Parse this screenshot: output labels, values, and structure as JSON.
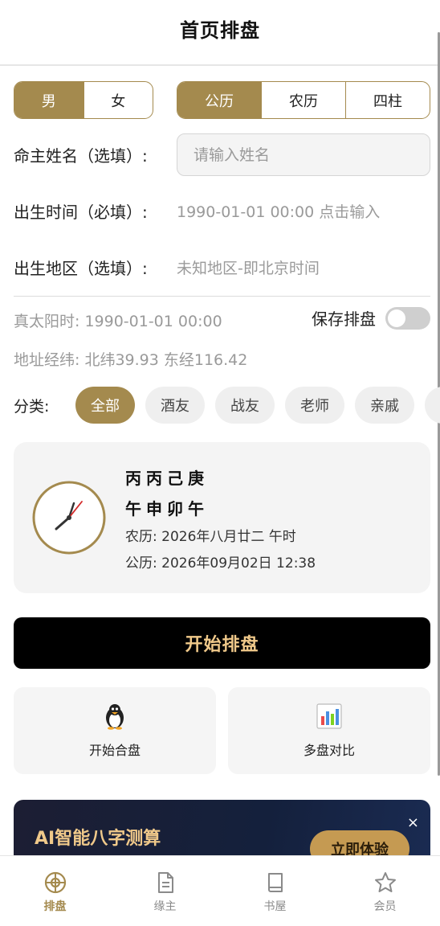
{
  "header": {
    "title": "首页排盘"
  },
  "gender": {
    "options": [
      "男",
      "女"
    ],
    "selected": 0
  },
  "calendar": {
    "options": [
      "公历",
      "农历",
      "四柱"
    ],
    "selected": 0
  },
  "form": {
    "name_label": "命主姓名（选填）:",
    "name_placeholder": "请输入姓名",
    "time_label": "出生时间（必填）:",
    "time_value": "1990-01-01 00:00 点击输入",
    "place_label": "出生地区（选填）:",
    "place_value": "未知地区-即北京时间"
  },
  "solar_time": "真太阳时: 1990-01-01 00:00",
  "save": {
    "label": "保存排盘",
    "enabled": false
  },
  "coords": "地址经纬: 北纬39.93 东经116.42",
  "category": {
    "label": "分类:",
    "chips": [
      "全部",
      "酒友",
      "战友",
      "老师",
      "亲戚",
      ""
    ],
    "selected": 0
  },
  "now_card": {
    "gan": "丙丙己庚",
    "zhi": "午申卯午",
    "lunar": "农历: 2026年八月廿二 午时",
    "solar": "公历: 2026年09月02日 12:38",
    "clock_icon": "clock-icon"
  },
  "start_button": "开始排盘",
  "tiles": [
    {
      "label": "开始合盘",
      "icon": "penguin-icon"
    },
    {
      "label": "多盘对比",
      "icon": "bar-chart-icon"
    }
  ],
  "banner": {
    "title": "AI智能八字测算",
    "button": "立即体验",
    "close": "×"
  },
  "tabbar": {
    "items": [
      {
        "label": "排盘",
        "icon": "compass-icon"
      },
      {
        "label": "缘主",
        "icon": "document-icon"
      },
      {
        "label": "书屋",
        "icon": "book-icon"
      },
      {
        "label": "会员",
        "icon": "star-icon"
      }
    ],
    "active": 0
  },
  "colors": {
    "accent": "#a48a4e",
    "banner_gold": "#f0c98a",
    "button_dark": "#000000"
  }
}
